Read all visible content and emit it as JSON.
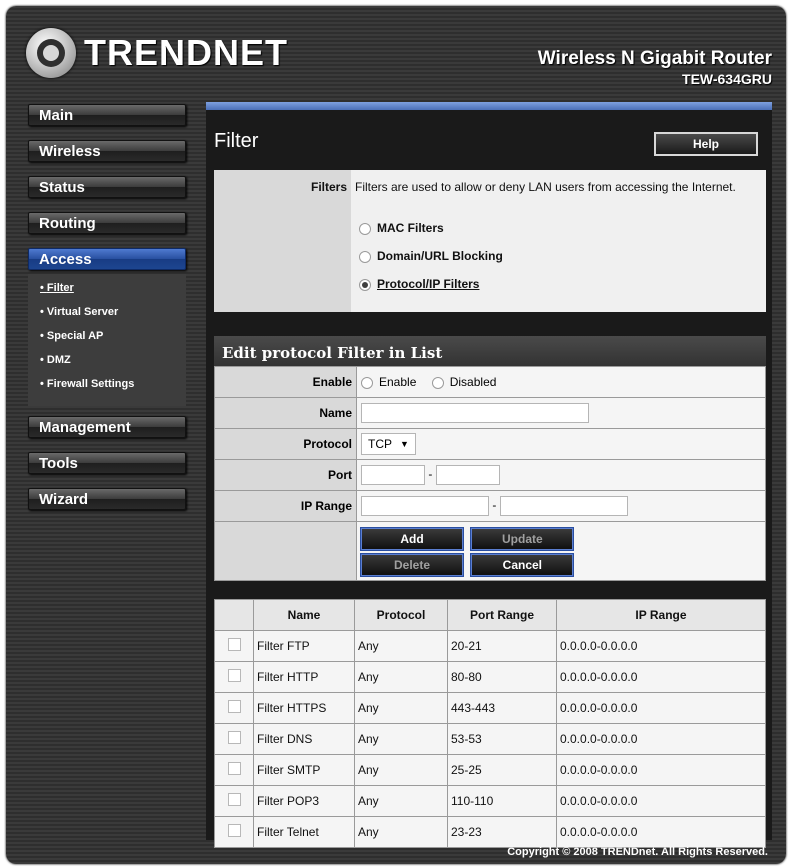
{
  "brand": {
    "logo_text": "TRENDNET",
    "product_name": "Wireless N Gigabit Router",
    "model": "TEW-634GRU"
  },
  "nav": {
    "main": "Main",
    "wireless": "Wireless",
    "status": "Status",
    "routing": "Routing",
    "access": "Access",
    "sub": [
      "Filter",
      "Virtual Server",
      "Special AP",
      "DMZ",
      "Firewall Settings"
    ],
    "management": "Management",
    "tools": "Tools",
    "wizard": "Wizard"
  },
  "page": {
    "title": "Filter",
    "help": "Help"
  },
  "filters": {
    "label": "Filters",
    "description": "Filters are used to allow or deny LAN users from accessing the Internet.",
    "options": [
      "MAC Filters",
      "Domain/URL Blocking",
      "Protocol/IP Filters"
    ],
    "selected": "Protocol/IP Filters"
  },
  "edit": {
    "heading": "Edit protocol Filter in List",
    "enable_label": "Enable",
    "enable_opt": "Enable",
    "disabled_opt": "Disabled",
    "name_label": "Name",
    "name_value": "",
    "protocol_label": "Protocol",
    "protocol_value": "TCP",
    "port_label": "Port",
    "ip_label": "IP Range",
    "dash": "-",
    "buttons": {
      "add": "Add",
      "update": "Update",
      "delete": "Delete",
      "cancel": "Cancel"
    }
  },
  "table": {
    "headers": [
      "Name",
      "Protocol",
      "Port Range",
      "IP Range"
    ],
    "rows": [
      [
        "Filter FTP",
        "Any",
        "20-21",
        "0.0.0.0-0.0.0.0"
      ],
      [
        "Filter HTTP",
        "Any",
        "80-80",
        "0.0.0.0-0.0.0.0"
      ],
      [
        "Filter HTTPS",
        "Any",
        "443-443",
        "0.0.0.0-0.0.0.0"
      ],
      [
        "Filter DNS",
        "Any",
        "53-53",
        "0.0.0.0-0.0.0.0"
      ],
      [
        "Filter SMTP",
        "Any",
        "25-25",
        "0.0.0.0-0.0.0.0"
      ],
      [
        "Filter POP3",
        "Any",
        "110-110",
        "0.0.0.0-0.0.0.0"
      ],
      [
        "Filter Telnet",
        "Any",
        "23-23",
        "0.0.0.0-0.0.0.0"
      ]
    ]
  },
  "footer": "Copyright © 2008 TRENDnet. All Rights Reserved."
}
